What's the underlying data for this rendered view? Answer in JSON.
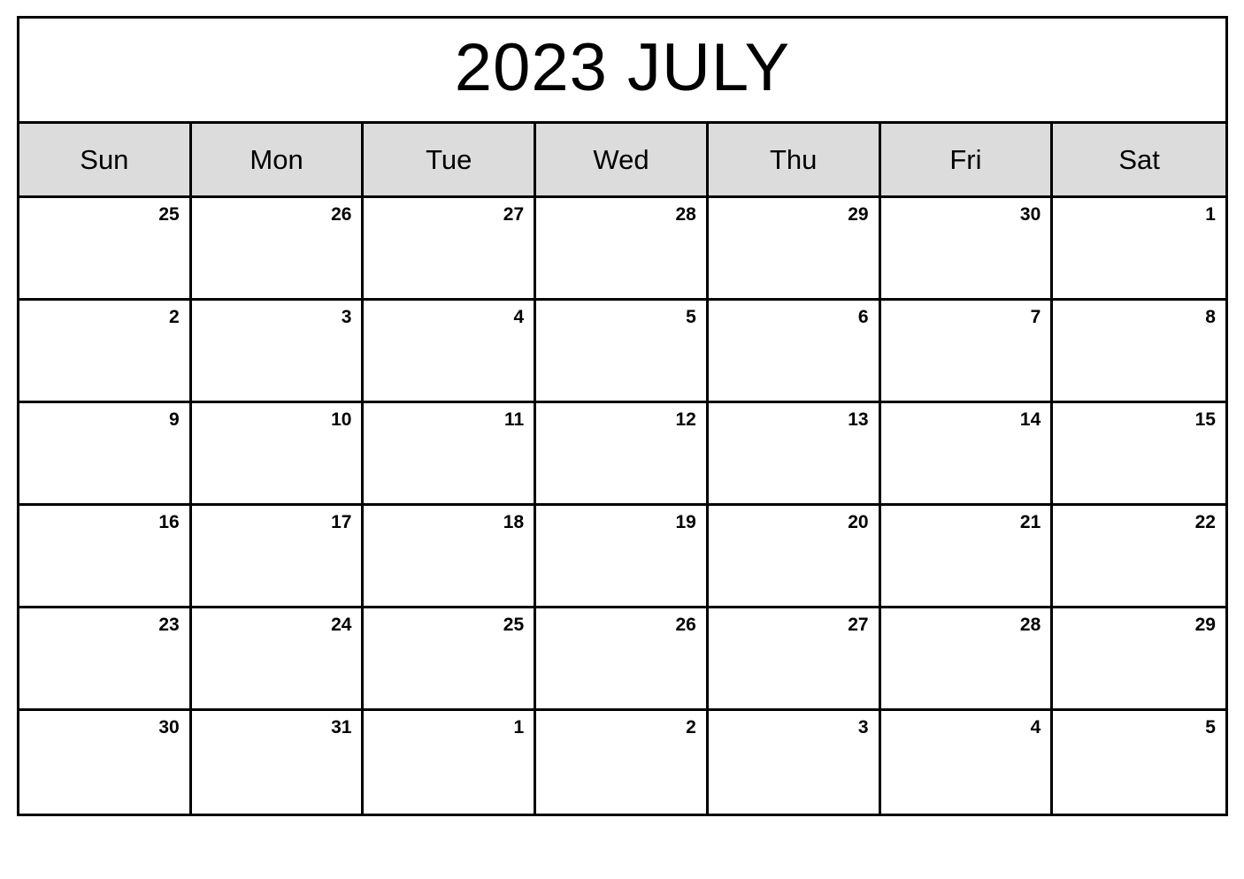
{
  "document": {
    "type": "printable-monthly-calendar",
    "title": "2023 JULY",
    "year": "2023",
    "month": "JULY"
  },
  "colors": {
    "page_background": "#ffffff",
    "border": "#000000",
    "weekday_header_background": "#dcdcdc",
    "text": "#000000"
  },
  "weekdays": [
    {
      "label": "Sun"
    },
    {
      "label": "Mon"
    },
    {
      "label": "Tue"
    },
    {
      "label": "Wed"
    },
    {
      "label": "Thu"
    },
    {
      "label": "Fri"
    },
    {
      "label": "Sat"
    }
  ],
  "weeks": [
    {
      "index": 1,
      "days": [
        {
          "number": "25",
          "in_month": false
        },
        {
          "number": "26",
          "in_month": false
        },
        {
          "number": "27",
          "in_month": false
        },
        {
          "number": "28",
          "in_month": false
        },
        {
          "number": "29",
          "in_month": false
        },
        {
          "number": "30",
          "in_month": false
        },
        {
          "number": "1",
          "in_month": true
        }
      ]
    },
    {
      "index": 2,
      "days": [
        {
          "number": "2",
          "in_month": true
        },
        {
          "number": "3",
          "in_month": true
        },
        {
          "number": "4",
          "in_month": true
        },
        {
          "number": "5",
          "in_month": true
        },
        {
          "number": "6",
          "in_month": true
        },
        {
          "number": "7",
          "in_month": true
        },
        {
          "number": "8",
          "in_month": true
        }
      ]
    },
    {
      "index": 3,
      "days": [
        {
          "number": "9",
          "in_month": true
        },
        {
          "number": "10",
          "in_month": true
        },
        {
          "number": "11",
          "in_month": true
        },
        {
          "number": "12",
          "in_month": true
        },
        {
          "number": "13",
          "in_month": true
        },
        {
          "number": "14",
          "in_month": true
        },
        {
          "number": "15",
          "in_month": true
        }
      ]
    },
    {
      "index": 4,
      "days": [
        {
          "number": "16",
          "in_month": true
        },
        {
          "number": "17",
          "in_month": true
        },
        {
          "number": "18",
          "in_month": true
        },
        {
          "number": "19",
          "in_month": true
        },
        {
          "number": "20",
          "in_month": true
        },
        {
          "number": "21",
          "in_month": true
        },
        {
          "number": "22",
          "in_month": true
        }
      ]
    },
    {
      "index": 5,
      "days": [
        {
          "number": "23",
          "in_month": true
        },
        {
          "number": "24",
          "in_month": true
        },
        {
          "number": "25",
          "in_month": true
        },
        {
          "number": "26",
          "in_month": true
        },
        {
          "number": "27",
          "in_month": true
        },
        {
          "number": "28",
          "in_month": true
        },
        {
          "number": "29",
          "in_month": true
        }
      ]
    },
    {
      "index": 6,
      "days": [
        {
          "number": "30",
          "in_month": true
        },
        {
          "number": "31",
          "in_month": true
        },
        {
          "number": "1",
          "in_month": false
        },
        {
          "number": "2",
          "in_month": false
        },
        {
          "number": "3",
          "in_month": false
        },
        {
          "number": "4",
          "in_month": false
        },
        {
          "number": "5",
          "in_month": false
        }
      ]
    }
  ]
}
